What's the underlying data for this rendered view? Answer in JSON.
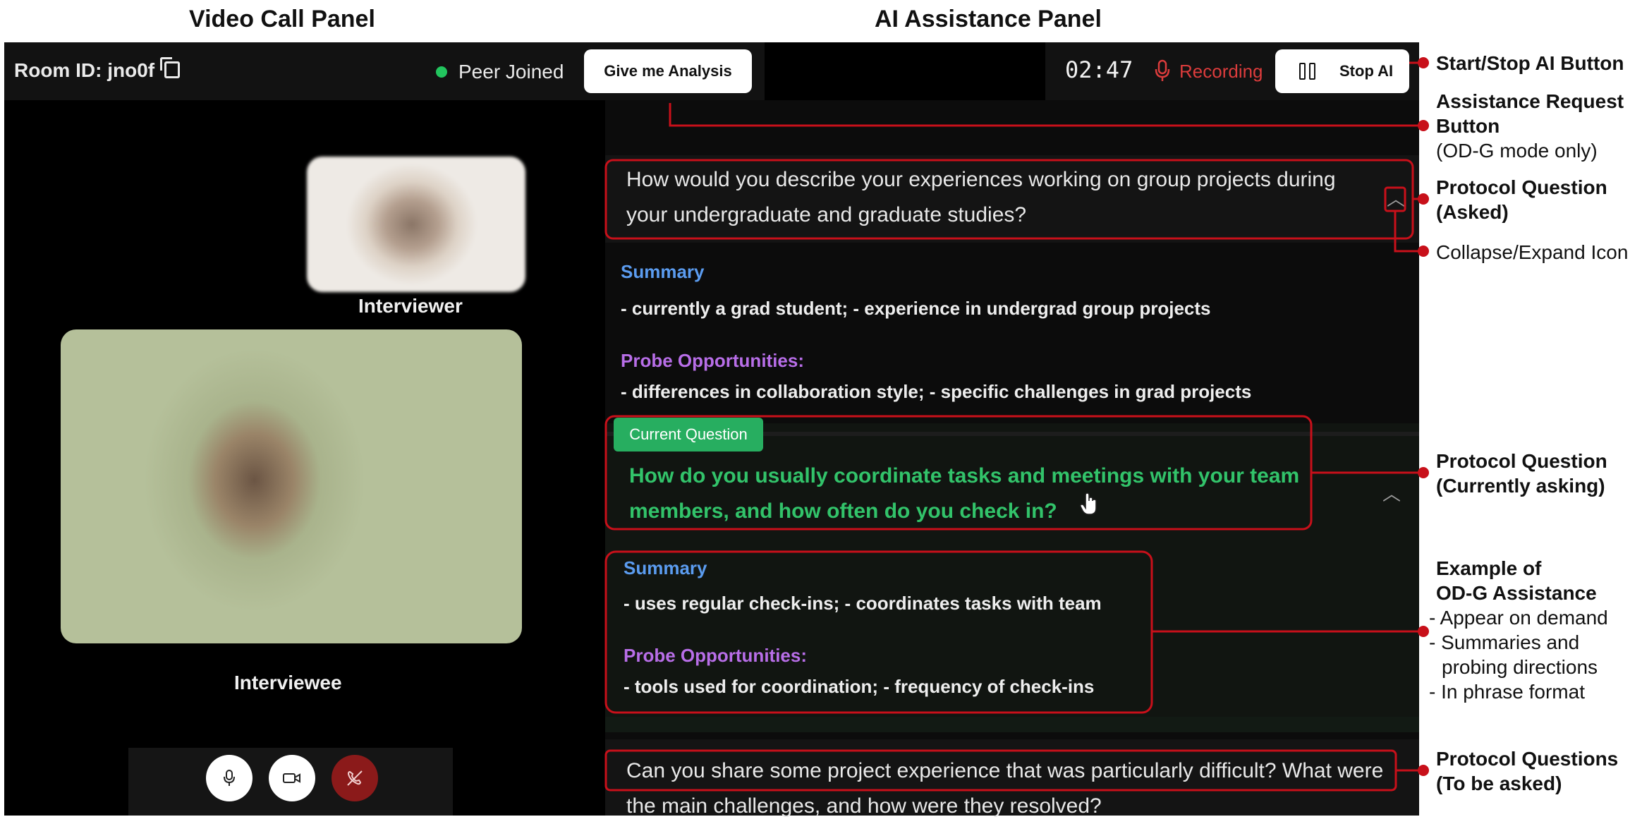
{
  "panel_titles": {
    "video": "Video Call Panel",
    "ai": "AI Assistance Panel"
  },
  "video_panel": {
    "room_id": "Room ID: jno0f",
    "peer_status": "Peer Joined",
    "analysis_button": "Give me Analysis",
    "interviewer_label": "Interviewer",
    "interviewee_label": "Interviewee",
    "controls": [
      "mic-icon",
      "camera-icon",
      "end-call-icon"
    ]
  },
  "ai_panel": {
    "timer": "02:47",
    "recording_label": "Recording",
    "stop_button": "Stop AI",
    "q1": "How would you describe your experiences working on group projects during your undergraduate and graduate studies?",
    "q1_summary_title": "Summary",
    "q1_summary": "- currently a grad student; - experience in undergrad group projects",
    "q1_probe_title": "Probe Opportunities:",
    "q1_probe": "- differences in collaboration style; - specific challenges in grad projects",
    "current_badge": "Current Question",
    "q2": "How do you usually coordinate tasks and meetings with your team members, and how often do you check in?",
    "q2_summary_title": "Summary",
    "q2_summary": "- uses regular check-ins; - coordinates tasks with team",
    "q2_probe_title": "Probe Opportunities:",
    "q2_probe": "- tools used for coordination; - frequency of check-ins",
    "q3": "Can you share some project experience that was particularly difficult? What were the main challenges, and how were they resolved?"
  },
  "annotations": {
    "start_stop": "Start/Stop AI Button",
    "assist_req_1": "Assistance Request",
    "assist_req_2": "Button",
    "assist_req_3": "(OD-G mode only)",
    "pq_asked_1": "Protocol Question",
    "pq_asked_2": "(Asked)",
    "collapse": "Collapse/Expand Icon",
    "pq_current_1": "Protocol Question",
    "pq_current_2": "(Currently asking)",
    "example_1": "Example of",
    "example_2": "OD-G Assistance",
    "example_3": "- Appear on demand",
    "example_4": "- Summaries and",
    "example_5": "probing directions",
    "example_6": "- In phrase format",
    "pq_tobe_1": "Protocol Questions",
    "pq_tobe_2": "(To be asked)"
  },
  "colors": {
    "annotation_red": "#c8101a",
    "current_green": "#32c36a",
    "summary_blue": "#5b9cf0",
    "probe_purple": "#b86ee8"
  }
}
